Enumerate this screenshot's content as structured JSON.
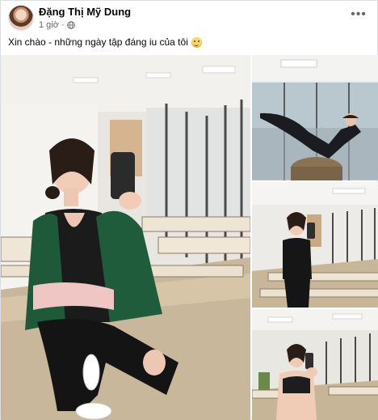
{
  "post": {
    "author_name": "Đặng Thị Mỹ Dung",
    "time": "1 giờ",
    "separator": "·",
    "caption": "Xin chào - những ngày tập đáng iu của tôi",
    "more_label": "•••"
  },
  "icons": {
    "avatar": "avatar",
    "privacy": "globe-icon",
    "more": "more-options-icon",
    "emoji": "smiling-face-icon"
  }
}
